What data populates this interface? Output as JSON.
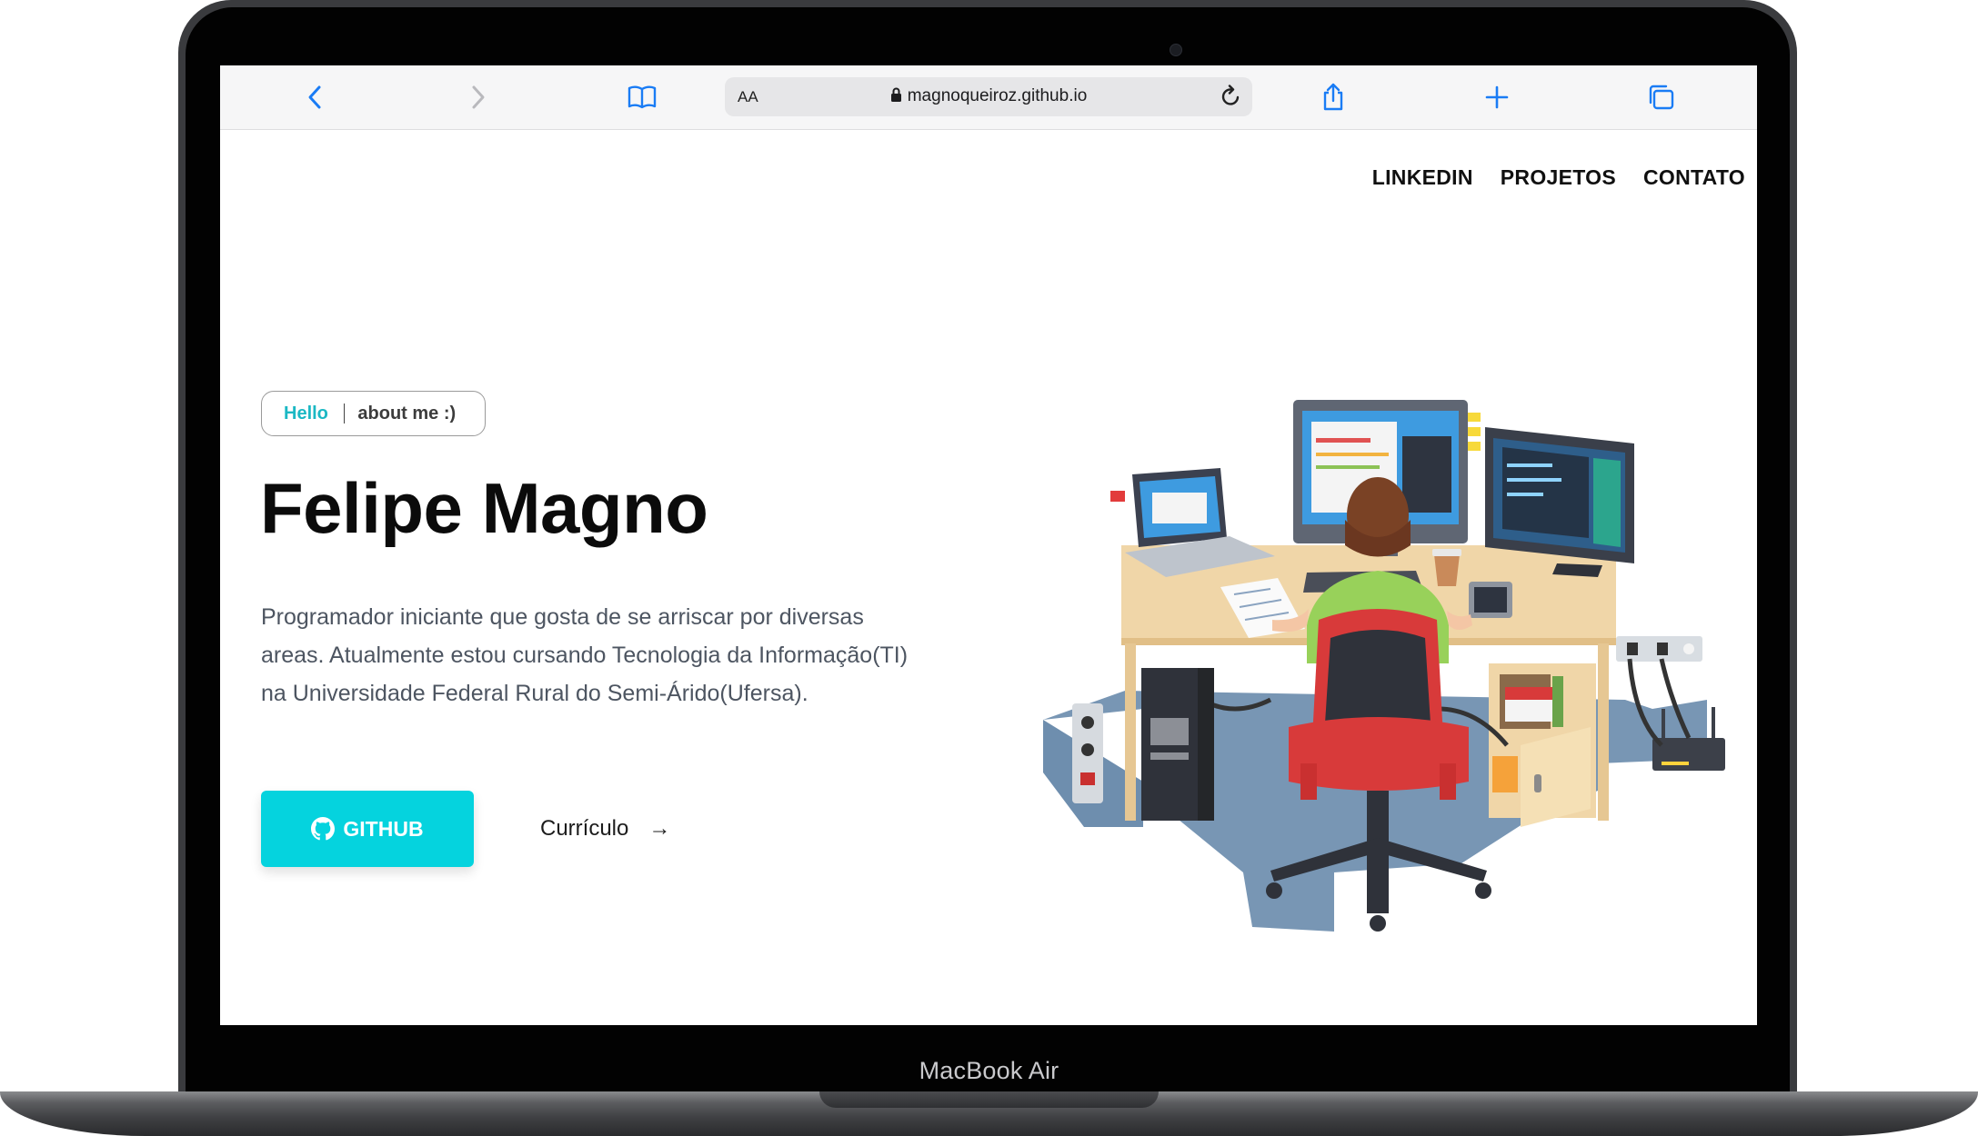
{
  "device": {
    "label": "MacBook Air"
  },
  "browser": {
    "text_size_label": "AA",
    "url": "magnoqueiroz.github.io",
    "icons": [
      "back-icon",
      "forward-icon",
      "bookmarks-icon",
      "lock-icon",
      "reload-icon",
      "share-icon",
      "new-tab-icon",
      "tabs-icon"
    ]
  },
  "nav": {
    "items": [
      {
        "label": "LINKEDIN"
      },
      {
        "label": "PROJETOS"
      },
      {
        "label": "CONTATO"
      }
    ]
  },
  "hero": {
    "pill": {
      "hello": "Hello",
      "about": "about me :)"
    },
    "name": "Felipe Magno",
    "description": "Programador iniciante que gosta de se arriscar por diversas areas. Atualmente estou cursando Tecnologia da Informação(TI) na Universidade Federal Rural do Semi-Árido(Ufersa).",
    "github_button": "GITHUB",
    "resume_link": "Currículo",
    "resume_arrow": "→"
  },
  "colors": {
    "accent": "#05d3de",
    "hello": "#1bb8c4",
    "text": "#4d5561"
  }
}
